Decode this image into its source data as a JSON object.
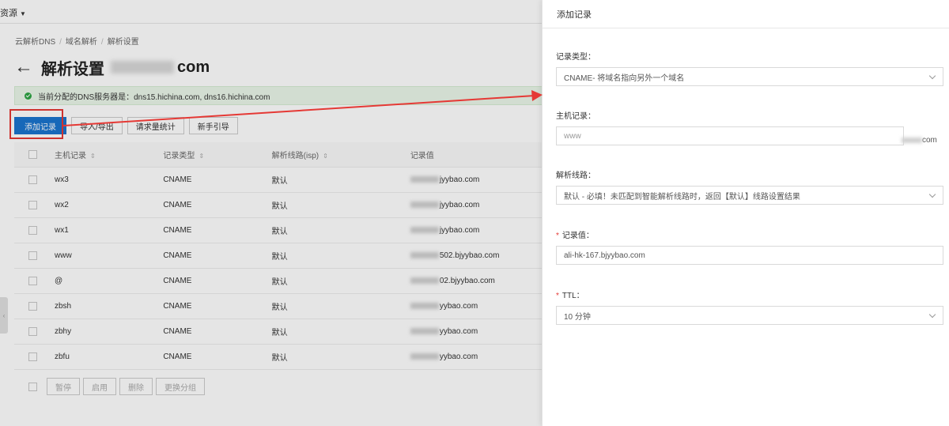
{
  "topbar": {
    "resource_label": "资源"
  },
  "breadcrumb": [
    "云解析DNS",
    "域名解析",
    "解析设置"
  ],
  "page": {
    "title": "解析设置",
    "title_suffix": "com"
  },
  "notice": {
    "text": "当前分配的DNS服务器是：dns15.hichina.com, dns16.hichina.com"
  },
  "toolbar": {
    "add_record": "添加记录",
    "import_export": "导入/导出",
    "request_stats": "请求量统计",
    "guide": "新手引导"
  },
  "table": {
    "headers": {
      "host": "主机记录",
      "type": "记录类型",
      "line": "解析线路(isp)",
      "value": "记录值"
    },
    "rows": [
      {
        "host": "wx3",
        "type": "CNAME",
        "line": "默认",
        "value": "jyybao.com"
      },
      {
        "host": "wx2",
        "type": "CNAME",
        "line": "默认",
        "value": "jyybao.com"
      },
      {
        "host": "wx1",
        "type": "CNAME",
        "line": "默认",
        "value": "jyybao.com"
      },
      {
        "host": "www",
        "type": "CNAME",
        "line": "默认",
        "value": "502.bjyybao.com"
      },
      {
        "host": "@",
        "type": "CNAME",
        "line": "默认",
        "value": "02.bjyybao.com"
      },
      {
        "host": "zbsh",
        "type": "CNAME",
        "line": "默认",
        "value": "yybao.com"
      },
      {
        "host": "zbhy",
        "type": "CNAME",
        "line": "默认",
        "value": "yybao.com"
      },
      {
        "host": "zbfu",
        "type": "CNAME",
        "line": "默认",
        "value": "yybao.com"
      }
    ]
  },
  "bulk_actions": [
    "暂停",
    "启用",
    "删除",
    "更换分组"
  ],
  "drawer": {
    "title": "添加记录",
    "record_type": {
      "label": "记录类型：",
      "value": "CNAME- 将域名指向另外一个域名"
    },
    "host_record": {
      "label": "主机记录：",
      "placeholder": "www",
      "suffix": "com"
    },
    "line": {
      "label": "解析线路：",
      "value": "默认 - 必填！未匹配到智能解析线路时，返回【默认】线路设置结果"
    },
    "record_value": {
      "label": "记录值：",
      "value": "ali-hk-167.bjyybao.com"
    },
    "ttl": {
      "label": "TTL：",
      "value": "10 分钟"
    }
  },
  "colors": {
    "primary": "#1a74cf",
    "annotation": "#e53935",
    "notice_bg": "#eaf6e9",
    "success": "#2ea543"
  }
}
